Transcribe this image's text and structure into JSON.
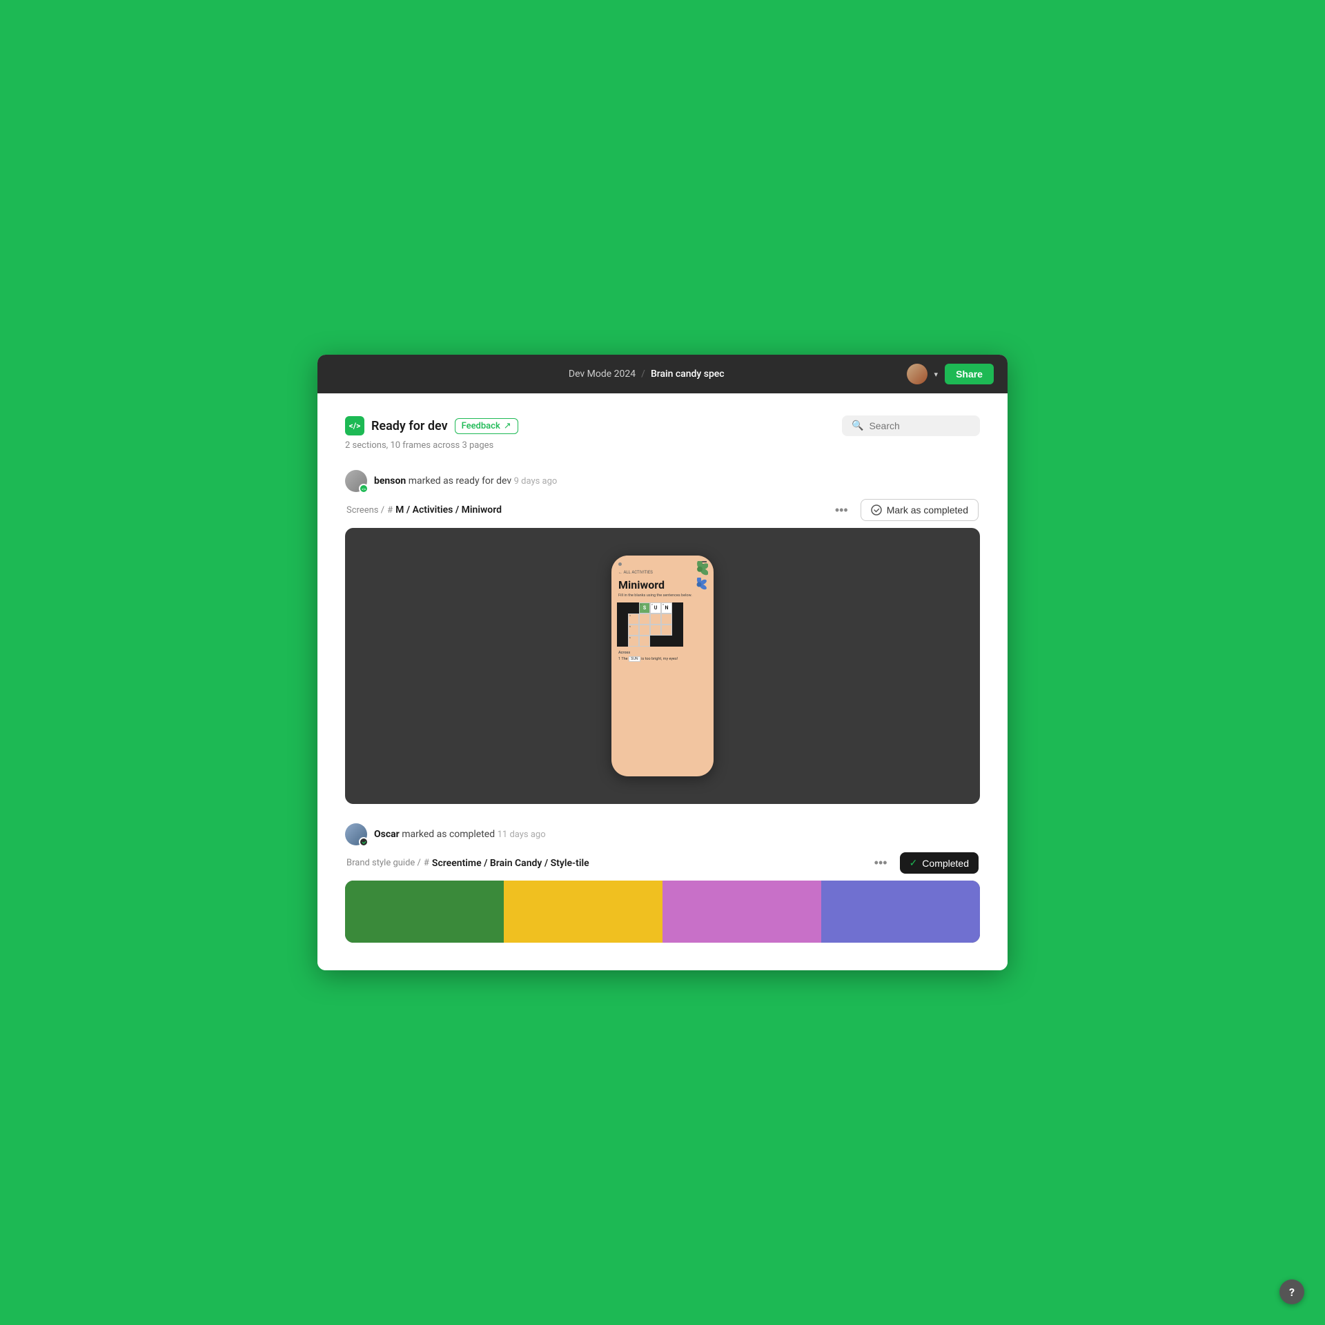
{
  "titlebar": {
    "project": "Dev Mode 2024",
    "separator": "/",
    "file_name": "Brain candy spec",
    "share_label": "Share"
  },
  "header": {
    "section_title": "Ready for dev",
    "feedback_label": "Feedback",
    "feedback_icon": "↗",
    "search_placeholder": "Search",
    "subtitle": "2 sections, 10 frames across 3 pages"
  },
  "activities": [
    {
      "user": "benson",
      "action": "marked as ready for dev",
      "time": "9 days ago",
      "path_prefix": "Screens /",
      "frame_name": "M / Activities / Miniword",
      "action_label": "Mark as completed",
      "status": "pending"
    },
    {
      "user": "Oscar",
      "action": "marked as completed",
      "time": "11 days ago",
      "path_prefix": "Brand style guide /",
      "frame_name": "Screentime / Brain Candy / Style-tile",
      "action_label": "Completed",
      "status": "completed"
    }
  ],
  "crossword": {
    "rows": [
      [
        "black",
        "black",
        "black",
        "S",
        "U",
        "N",
        "black"
      ],
      [
        "black",
        "black",
        "black",
        "black",
        "black",
        "black",
        "black"
      ],
      [
        "black",
        "black",
        "black",
        "black",
        "black",
        "black",
        "black"
      ],
      [
        "black",
        "black",
        "black",
        "black",
        "black",
        "black",
        "black"
      ],
      [
        "black",
        "black",
        "black",
        "black",
        "black",
        "black",
        "black"
      ],
      [
        "black",
        "black",
        "black",
        "black",
        "black",
        "black",
        "black"
      ]
    ],
    "clue": "The SUN is too bright, my eyes!"
  },
  "style_tiles": [
    {
      "color": "#3a8a3a"
    },
    {
      "color": "#f0c020"
    },
    {
      "color": "#c870c8"
    },
    {
      "color": "#7070d0"
    }
  ],
  "help_btn": "?"
}
